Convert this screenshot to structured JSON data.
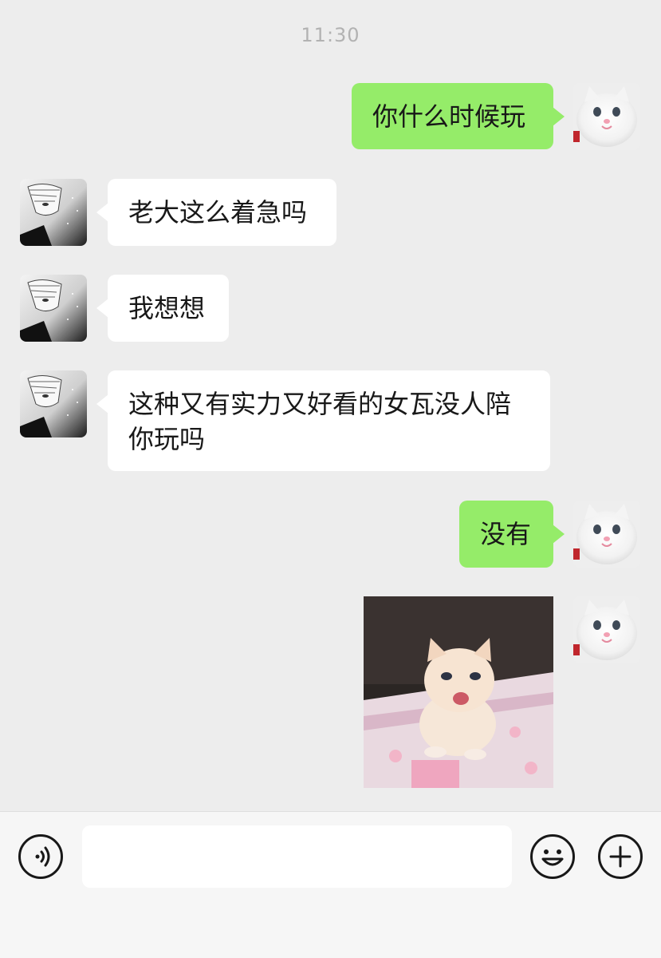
{
  "chat": {
    "timestamp": "11:30",
    "messages": [
      {
        "side": "right",
        "type": "text",
        "text": "你什么时候玩"
      },
      {
        "side": "left",
        "type": "text",
        "text": "老大这么着急吗"
      },
      {
        "side": "left",
        "type": "text",
        "text": "我想想"
      },
      {
        "side": "left",
        "type": "text",
        "text": "这种又有实力又好看的女瓦没人陪你玩吗"
      },
      {
        "side": "right",
        "type": "text",
        "text": "没有"
      },
      {
        "side": "right",
        "type": "image",
        "image": "kitten-photo"
      }
    ]
  },
  "input_bar": {
    "voice_icon": "voice-icon",
    "message_value": "",
    "emoji_icon": "emoji-icon",
    "plus_icon": "plus-icon"
  },
  "colors": {
    "background": "#ededed",
    "outgoing_bubble": "#95ec69",
    "incoming_bubble": "#ffffff",
    "timestamp": "#b2b2b2",
    "input_bar": "#f6f6f6"
  }
}
